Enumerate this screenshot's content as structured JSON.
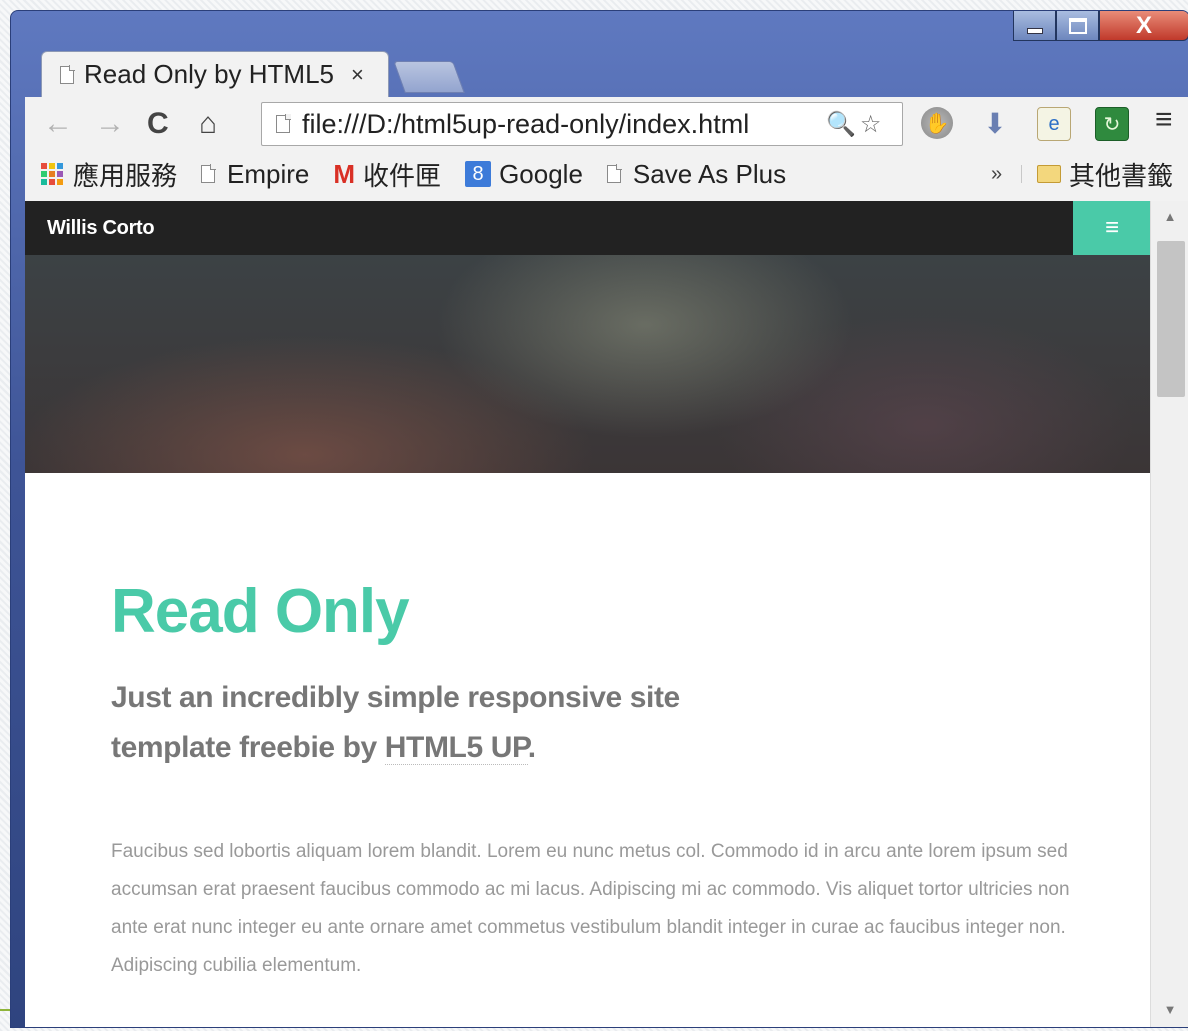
{
  "window": {
    "controls": {
      "minimize": "",
      "maximize": "",
      "close": "X"
    }
  },
  "tab": {
    "title": "Read Only by HTML5 UP",
    "close": "×"
  },
  "toolbar": {
    "back_icon": "←",
    "forward_icon": "→",
    "reload_icon": "C",
    "home_icon": "⌂",
    "url": "file:///D:/html5up-read-only/index.html",
    "zoom_icon": "🔍",
    "star_icon": "☆",
    "menu_icon": "≡"
  },
  "extensions": [
    "hand-stop-icon",
    "download-icon",
    "ie-tab-icon",
    "refresh-green-icon"
  ],
  "bookmarks": {
    "items": [
      {
        "label": "應用服務",
        "icon": "apps-grid-icon"
      },
      {
        "label": "Empire",
        "icon": "page-icon"
      },
      {
        "label": "收件匣",
        "icon": "gmail-icon"
      },
      {
        "label": "Google",
        "icon": "google-icon"
      },
      {
        "label": "Save As Plus",
        "icon": "page-icon"
      }
    ],
    "more": "»",
    "other": "其他書籤"
  },
  "site": {
    "name": "Willis Corto",
    "menu_icon": "≡",
    "accent": "#4acaa8",
    "heading": "Read Only",
    "subheading_text": "Just an incredibly simple responsive site template freebie by ",
    "subheading_link": "HTML5 UP",
    "subheading_end": ".",
    "body": "Faucibus sed lobortis aliquam lorem blandit. Lorem eu nunc metus col. Commodo id in arcu ante lorem ipsum sed accumsan erat praesent faucibus commodo ac mi lacus. Adipiscing mi ac commodo. Vis aliquet tortor ultricies non ante erat nunc integer eu ante ornare amet commetus vestibulum blandit integer in curae ac faucibus integer non. Adipiscing cubilia elementum."
  },
  "scrollbar": {
    "up": "▲",
    "down": "▼"
  }
}
